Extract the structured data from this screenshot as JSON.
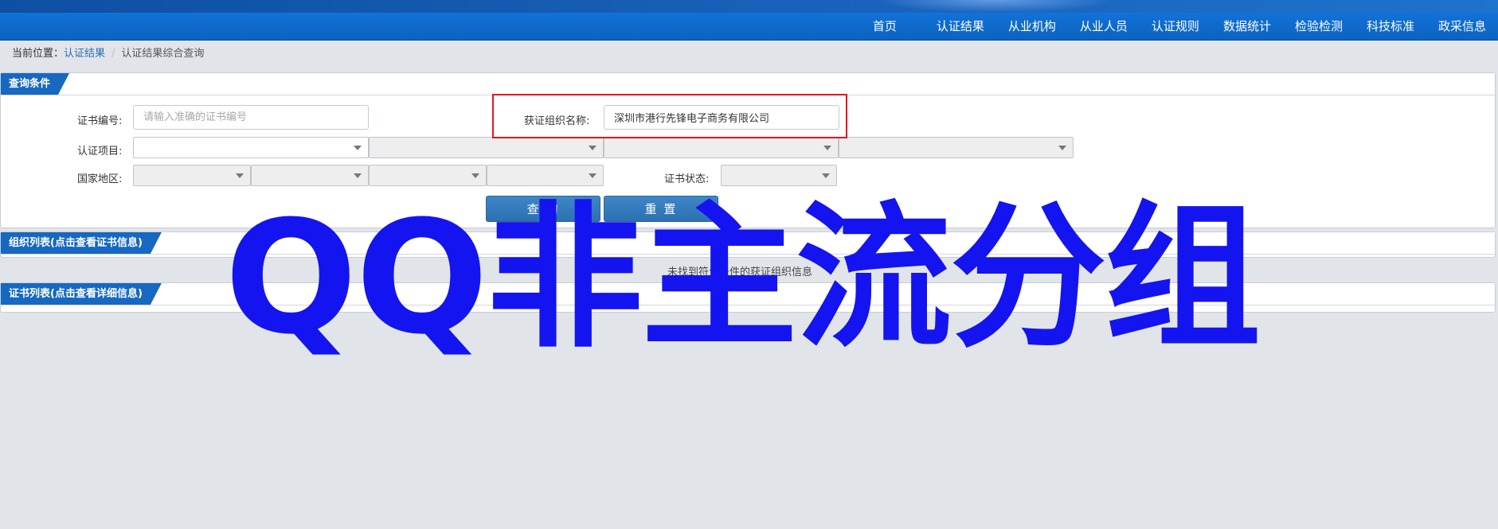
{
  "nav": {
    "items": [
      "首页",
      "认证结果",
      "从业机构",
      "从业人员",
      "认证规则",
      "数据统计",
      "检验检测",
      "科技标准",
      "政采信息"
    ]
  },
  "breadcrumb": {
    "prefix": "当前位置：",
    "link": "认证结果",
    "separator": "/",
    "current": "认证结果综合查询"
  },
  "query_panel": {
    "title": "查询条件",
    "cert_no_label": "证书编号:",
    "cert_no_placeholder": "请输入准确的证书编号",
    "org_name_label": "获证组织名称:",
    "org_name_value": "深圳市港行先锋电子商务有限公司",
    "cert_item_label": "认证项目:",
    "region_label": "国家地区:",
    "status_label": "证书状态:",
    "query_button": "查 询",
    "reset_button": "重 置"
  },
  "org_list_panel": {
    "title": "组织列表(点击查看证书信息)",
    "empty_message": "未找到符合条件的获证组织信息"
  },
  "cert_list_panel": {
    "title": "证书列表(点击查看详细信息)"
  },
  "watermark": {
    "text": "QQ非主流分组"
  },
  "colors": {
    "nav_bg": "#0b63c2",
    "panel_tag": "#1668c1",
    "button": "#3578b8",
    "highlight": "#e8141b",
    "watermark": "#1414f0"
  }
}
